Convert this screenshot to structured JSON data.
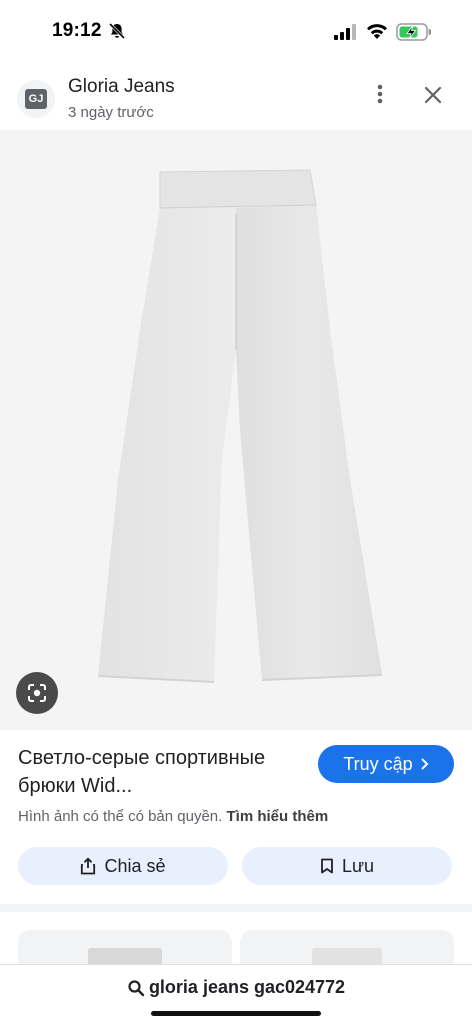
{
  "status_bar": {
    "time": "19:12",
    "battery_color": "#34c759"
  },
  "header": {
    "avatar_text": "GJ",
    "source_name": "Gloria Jeans",
    "posted_time": "3 ngày trước"
  },
  "product": {
    "title": "Светло-серые спортивные брюки Wid...",
    "visit_label": "Truy cập",
    "copyright_text": "Hình ảnh có thể có bản quyền.",
    "learn_more_label": "Tìm hiểu thêm",
    "share_label": "Chia sẻ",
    "save_label": "Lưu"
  },
  "search": {
    "query": "gloria jeans gac024772"
  },
  "colors": {
    "accent": "#1a73e8",
    "button_bg": "#e8f0fe"
  }
}
